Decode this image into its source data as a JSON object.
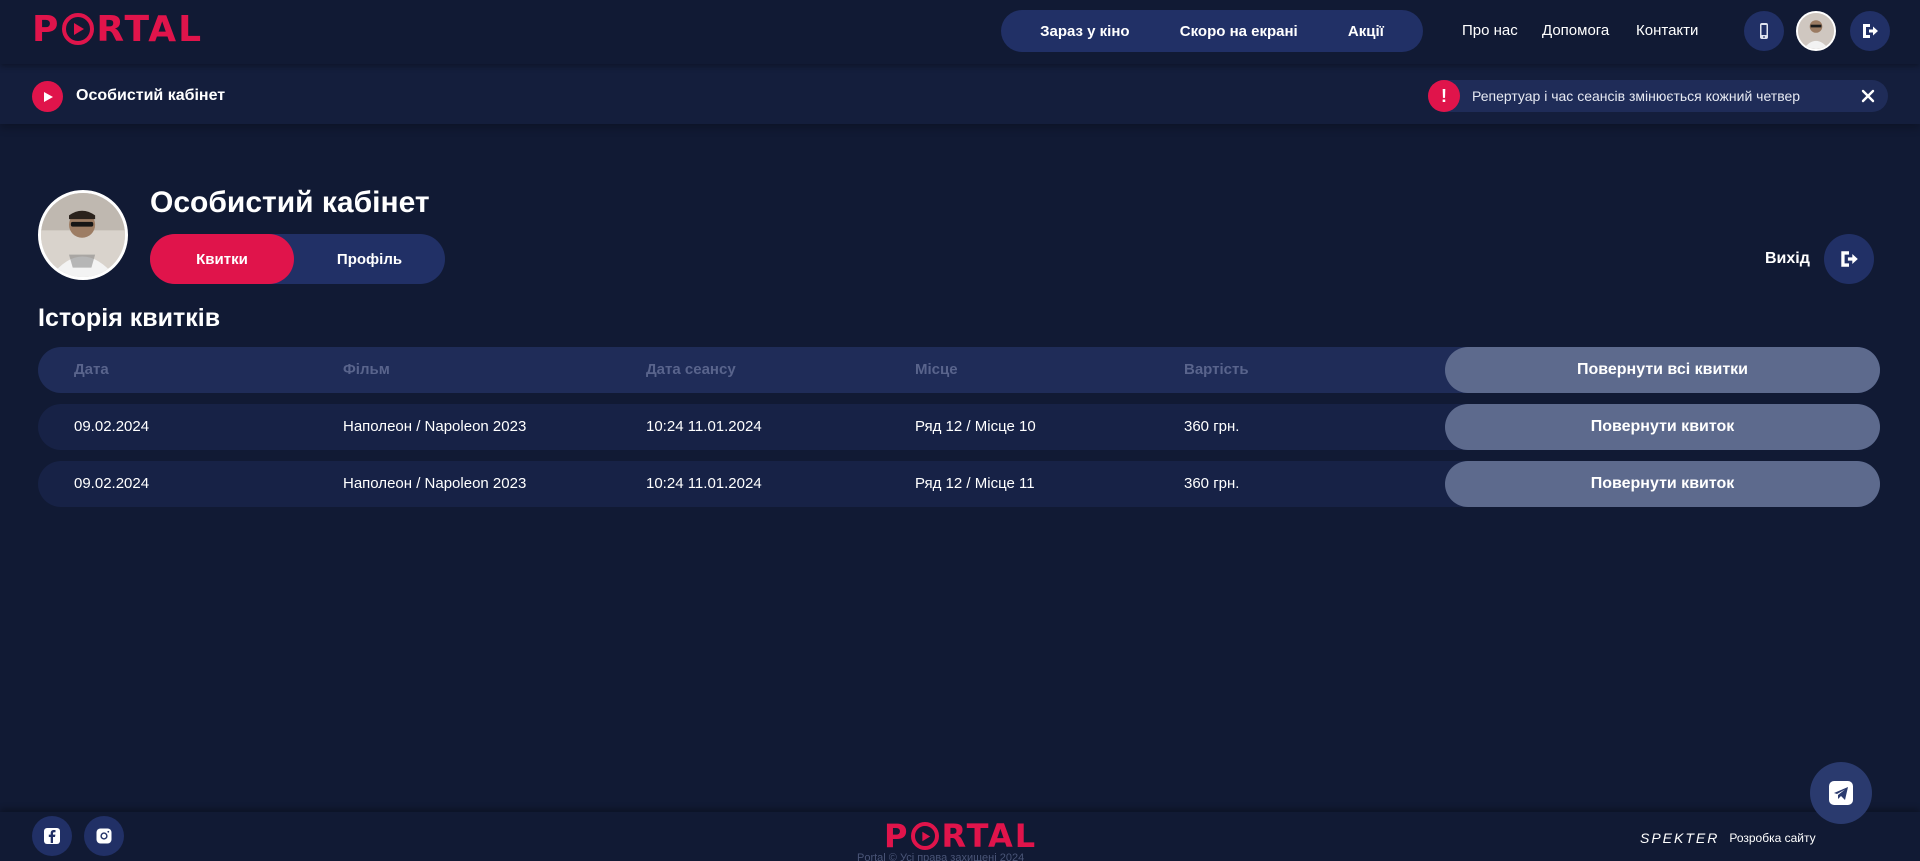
{
  "header": {
    "logo_left": "P",
    "logo_right": "RTAL",
    "nav": [
      "Зараз у кіно",
      "Скоро на екрані",
      "Акції"
    ],
    "links": [
      "Про нас",
      "Допомога",
      "Контакти"
    ]
  },
  "subbar": {
    "title": "Особистий кабінет",
    "notice": "Репертуар і час сеансів змінюється кожний четвер"
  },
  "profile": {
    "title": "Особистий кабінет",
    "tabs": [
      "Квитки",
      "Профіль"
    ],
    "logout_label": "Вихід"
  },
  "history": {
    "title": "Історія квитків",
    "columns": [
      "Дата",
      "Фільм",
      "Дата сеансу",
      "Місце",
      "Вартість"
    ],
    "return_all_label": "Повернути всі квитки",
    "rows": [
      {
        "date": "09.02.2024",
        "film": "Наполеон / Napoleon 2023",
        "session": "10:24 11.01.2024",
        "seat": "Ряд 12 / Місце 10",
        "price": "360 грн.",
        "action": "Повернути квиток"
      },
      {
        "date": "09.02.2024",
        "film": "Наполеон / Napoleon 2023",
        "session": "10:24 11.01.2024",
        "seat": "Ряд 12 / Місце 11",
        "price": "360 грн.",
        "action": "Повернути квиток"
      }
    ]
  },
  "footer": {
    "logo_left": "P",
    "logo_right": "RTAL",
    "copyright": "Portal © Усі права захищені 2024",
    "dev_brand": "SPEKTER",
    "dev_label": "Розробка сайту"
  },
  "icons": {
    "phone": "phone-icon",
    "logout": "logout-icon",
    "play": "play-icon",
    "warning": "exclamation-icon",
    "close": "close-icon",
    "facebook": "facebook-icon",
    "instagram": "instagram-icon",
    "telegram": "telegram-icon"
  },
  "colors": {
    "background": "#111a34",
    "accent": "#e0144b",
    "pill": "#213066",
    "return_button": "#5d6a8d"
  }
}
